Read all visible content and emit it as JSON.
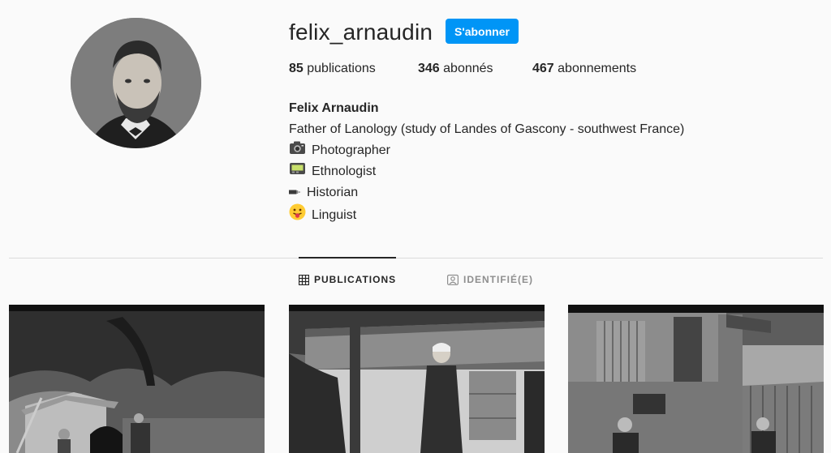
{
  "profile": {
    "username": "felix_arnaudin",
    "follow_label": "S'abonner",
    "stats": [
      {
        "count": "85",
        "label": "publications"
      },
      {
        "count": "346",
        "label": "abonnés"
      },
      {
        "count": "467",
        "label": "abonnements"
      }
    ],
    "name": "Felix Arnaudin",
    "bio": [
      {
        "icon": "camera-emoji",
        "text": "Father of Lanology (study of Landes of Gascony - southwest France)"
      },
      {
        "icon": "camera-emoji",
        "text": "Photographer"
      },
      {
        "icon": "pager-emoji",
        "text": "Ethnologist"
      },
      {
        "icon": "pen-emoji",
        "text": "Historian"
      },
      {
        "icon": "tongue-face-emoji",
        "text": "Linguist"
      }
    ]
  },
  "tabs": [
    {
      "label": "PUBLICATIONS",
      "icon": "grid-icon",
      "active": true
    },
    {
      "label": "IDENTIFIÉ(E)",
      "icon": "tag-user-icon",
      "active": false
    }
  ],
  "posts": [
    {
      "subject": "bread-oven-photo"
    },
    {
      "subject": "woman-by-house-photo"
    },
    {
      "subject": "barn-workers-photo"
    }
  ],
  "colors": {
    "accent": "#0095f6",
    "text": "#262626",
    "muted": "#8e8e8e",
    "background": "#fafafa"
  }
}
